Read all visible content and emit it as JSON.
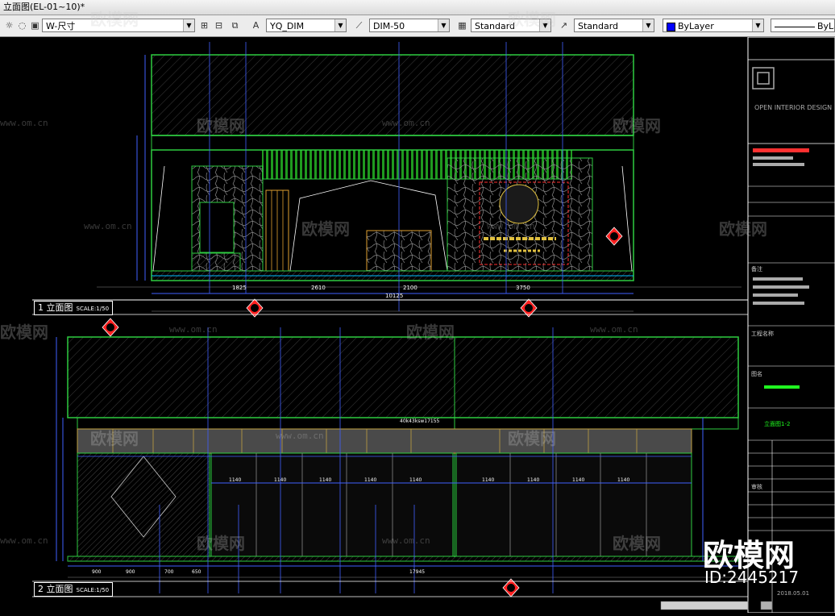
{
  "window": {
    "title": "立面图(EL-01~10)*"
  },
  "toolbar": {
    "dim_style": "W-尺寸",
    "text_style": "YQ_DIM",
    "dim_scale": "DIM-50",
    "table_style": "Standard",
    "multileader_style": "Standard",
    "color": "ByLayer",
    "linetype": "ByLa"
  },
  "views": [
    {
      "number": "1",
      "label": "立面图",
      "scale": "SCALE:1/50"
    },
    {
      "number": "2",
      "label": "立面图",
      "scale": "SCALE:1/50"
    }
  ],
  "titleblock": {
    "firm": "OPEN INTERIOR DESIGN",
    "note_label": "备注",
    "project_label": "工程名称",
    "drawing_label": "图名",
    "drawing_name": "立面图1-2",
    "check_label": "审核",
    "date": "2018.05.01"
  },
  "dims": {
    "v1": [
      "1825",
      "2610",
      "2100",
      "3750"
    ],
    "v1_sub": "10125",
    "v2": [
      "1140",
      "1140",
      "1140",
      "1140",
      "1140",
      "1140",
      "1140",
      "1140",
      "1140"
    ],
    "v2_bottom": [
      "900",
      "900",
      "700",
      "650",
      "17945"
    ],
    "v2_span": "40k43ksw17155"
  },
  "watermark": {
    "brand": "欧模网",
    "url": "www.om.cn",
    "id": "ID:2445217"
  }
}
